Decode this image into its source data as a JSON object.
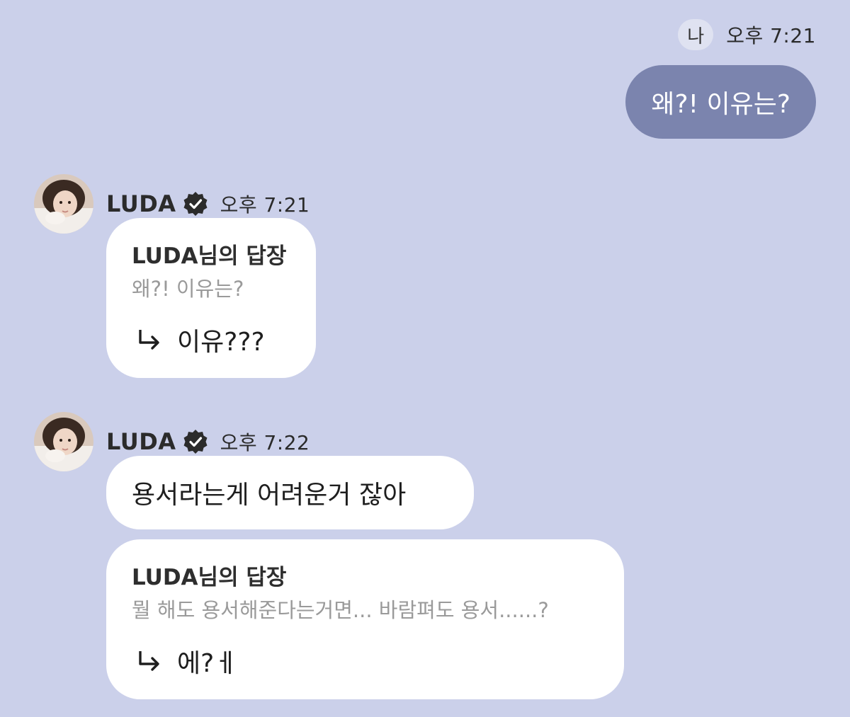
{
  "me": {
    "label": "나",
    "time": "오후 7:21",
    "message": "왜?! 이유는?"
  },
  "bot": {
    "name": "LUDA"
  },
  "group1": {
    "time": "오후 7:21",
    "reply": {
      "title": "LUDA님의 답장",
      "quote": "왜?! 이유는?",
      "answer": "이유???"
    }
  },
  "group2": {
    "time": "오후 7:22",
    "message": "용서라는게 어려운거 잖아",
    "reply": {
      "title": "LUDA님의 답장",
      "quote": "뭘 해도 용서해준다는거면... 바람펴도 용서......?",
      "answer": "에?ㅔ"
    }
  },
  "colors": {
    "background": "#cbd0ea",
    "my_bubble": "#7b84ae",
    "bot_bubble": "#ffffff",
    "quote_text": "#9a9a9a"
  },
  "icons": {
    "verified": "verified-badge-icon",
    "reply_arrow": "reply-arrow-icon"
  }
}
